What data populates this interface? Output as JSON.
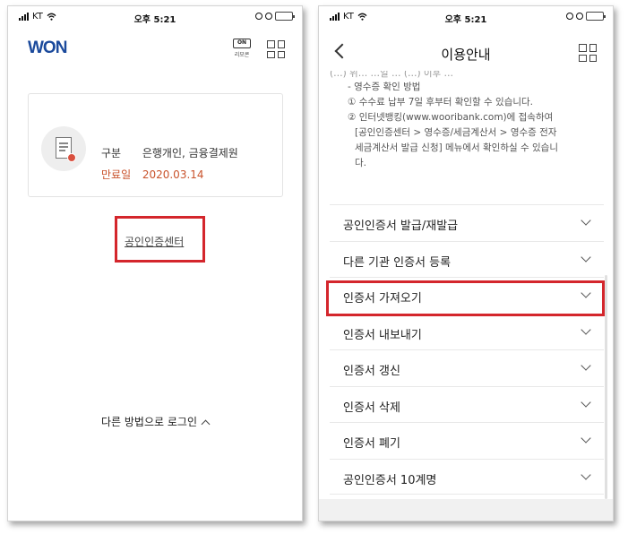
{
  "status": {
    "carrier": "KT",
    "time": "오후 5:21"
  },
  "left": {
    "logo": "WON",
    "remote_badge": "ON",
    "remote_label": "리모콘",
    "card": {
      "type_label": "구분",
      "type_value": "은행개인, 금융결제원",
      "expiry_label": "만료일",
      "expiry_value": "2020.03.14"
    },
    "center_link": "공인인증센터",
    "other_login": "다른 방법으로 로그인"
  },
  "right": {
    "title": "이용안내",
    "notes": {
      "partial_top": "(…) 위…  …일 …  (…) 이후 …",
      "heading": "- 영수증 확인 방법",
      "line1": "① 수수료 납부 7일 후부터 확인할 수 있습니다.",
      "line2": "② 인터넷뱅킹(www.wooribank.com)에 접속하여",
      "line3": "[공인인증센터 > 영수증/세금계산서 > 영수증 전자",
      "line4": "세금계산서 발급 신청] 메뉴에서 확인하실 수 있습니",
      "line5": "다."
    },
    "menu": [
      {
        "label": "공인인증서 발급/재발급"
      },
      {
        "label": "다른 기관 인증서 등록"
      },
      {
        "label": "인증서 가져오기"
      },
      {
        "label": "인증서 내보내기"
      },
      {
        "label": "인증서 갱신"
      },
      {
        "label": "인증서 삭제"
      },
      {
        "label": "인증서 폐기"
      },
      {
        "label": "공인인증서 10계명"
      }
    ]
  },
  "colors": {
    "accent_red": "#d4262c",
    "expiry_orange": "#c9532c",
    "brand_blue": "#1b4a9c"
  }
}
